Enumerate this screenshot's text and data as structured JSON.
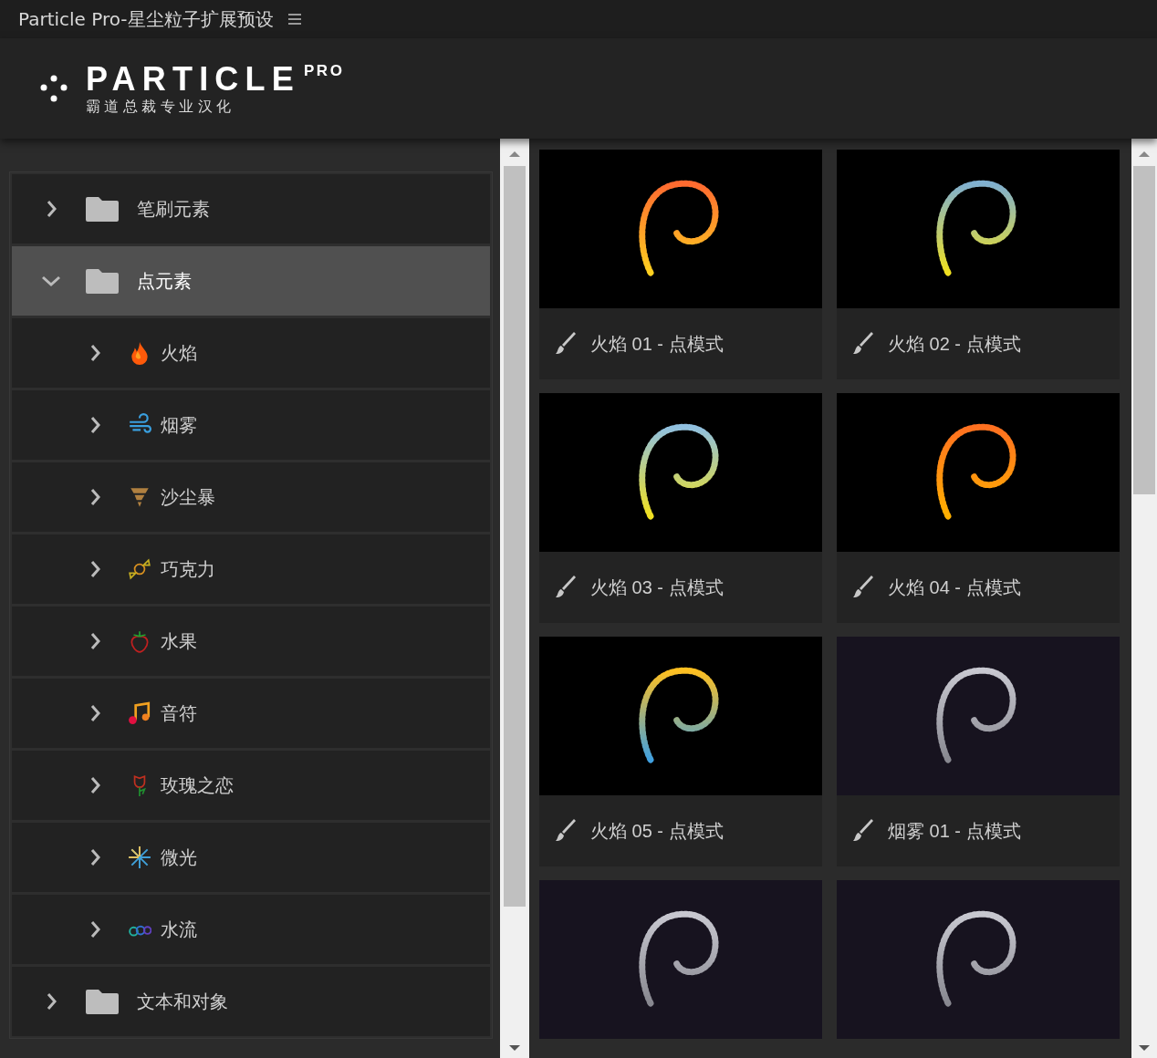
{
  "window": {
    "title": "Particle Pro-星尘粒子扩展预设"
  },
  "logo": {
    "name": "PARTICLE",
    "badge": "PRO",
    "subtitle": "霸 道 总 裁 专 业 汉 化"
  },
  "tree": [
    {
      "label": "笔刷元素",
      "expanded": false,
      "selected": false
    },
    {
      "label": "点元素",
      "expanded": true,
      "selected": true,
      "children": [
        {
          "label": "火焰",
          "expanded": false,
          "selected": false
        },
        {
          "label": "烟雾",
          "expanded": false,
          "selected": false
        },
        {
          "label": "沙尘暴",
          "expanded": false,
          "selected": false
        },
        {
          "label": "巧克力",
          "expanded": false,
          "selected": false
        },
        {
          "label": "水果",
          "expanded": false,
          "selected": false
        },
        {
          "label": "音符",
          "expanded": false,
          "selected": false
        },
        {
          "label": "玫瑰之恋",
          "expanded": false,
          "selected": false
        },
        {
          "label": "微光",
          "expanded": false,
          "selected": false
        },
        {
          "label": "水流",
          "expanded": false,
          "selected": false
        }
      ]
    },
    {
      "label": "文本和对象",
      "expanded": false,
      "selected": false
    }
  ],
  "presets": [
    {
      "caption": "火焰 01 - 点模式",
      "kind": "fire"
    },
    {
      "caption": "火焰 02 - 点模式",
      "kind": "fire"
    },
    {
      "caption": "火焰 03 - 点模式",
      "kind": "fire"
    },
    {
      "caption": "火焰 04 - 点模式",
      "kind": "fire"
    },
    {
      "caption": "火焰 05 - 点模式",
      "kind": "fire"
    },
    {
      "caption": "烟雾 01 - 点模式",
      "kind": "smoke"
    },
    {
      "kind": "smoke"
    },
    {
      "kind": "smoke"
    }
  ]
}
